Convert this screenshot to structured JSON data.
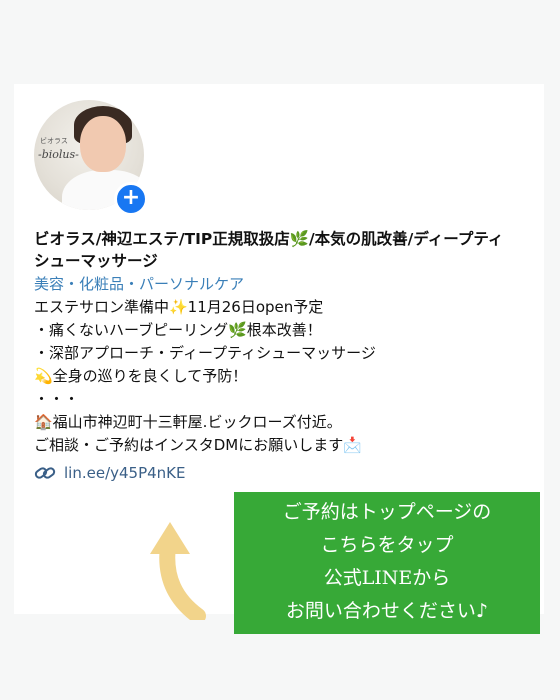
{
  "profile": {
    "avatar_brand_small": "ビオラス",
    "avatar_brand": "-biolus-",
    "name": "ビオラス/神辺エステ/TIP正規取扱店🌿/本気の肌改善/ディープティシューマッサージ",
    "category": "美容・化粧品・パーソナルケア",
    "bio_lines": [
      "エステサロン準備中✨11月26日open予定",
      "・痛くないハーブピーリング🌿根本改善！",
      "・深部アプローチ・ディープティシューマッサージ",
      "💫全身の巡りを良くして予防！",
      "・・・",
      "🏠福山市神辺町十三軒屋.ビックローズ付近。",
      "ご相談・ご予約はインスタDMにお願いします📩"
    ],
    "link": "lin.ee/y45P4nKE"
  },
  "callout": {
    "lines": [
      "ご予約はトップページの",
      "こちらをタップ",
      "公式LINEから",
      "お問い合わせください♪"
    ]
  },
  "colors": {
    "callout_bg": "#37a937",
    "arrow": "#f2d48b",
    "link": "#3a5f87",
    "category": "#3a7fb8",
    "follow_badge": "#1877f2"
  },
  "icons": {
    "follow": "plus-icon",
    "link": "link-chain-icon",
    "arrow": "curved-arrow-icon"
  }
}
